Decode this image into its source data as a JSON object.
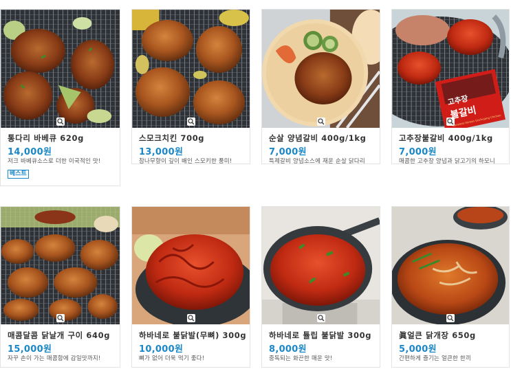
{
  "products": [
    {
      "name": "통다리 바베큐 620g",
      "price": "14,000원",
      "desc": "저크 바베큐소스로 더한 이국적인 맛!",
      "badge": "베스트"
    },
    {
      "name": "스모크치킨 700g",
      "price": "13,000원",
      "desc": "참나무향이 깊이 배인 스모키한 풍미!"
    },
    {
      "name": "순살 양념갈비 400g/1kg",
      "price": "7,000원",
      "desc": "특제갈비 양념소스에 재운 순살 닭다리"
    },
    {
      "name": "고추장불갈비 400g/1kg",
      "price": "7,000원",
      "desc": "매콤한 고추장 양념과 닭고기의 하모니"
    },
    {
      "name": "매콤달콤 닭날개 구이 640g",
      "price": "15,000원",
      "desc": "자꾸 손이 가는 매콤함에 감일맛까지!"
    },
    {
      "name": "하바네로 불닭발(무뼈) 300g",
      "price": "10,000원",
      "desc": "뼈가 없어 더욱 먹기 좋다!"
    },
    {
      "name": "하바네로 튤립 불닭발 300g",
      "price": "8,000원",
      "desc": "중독되는 화끈한 매운 맛!"
    },
    {
      "name": "眞얼큰 닭개장 650g",
      "price": "5,000원",
      "desc": "간편하게 즐기는 얼큰한 한끼"
    }
  ],
  "product_images": [
    "grill-bbq-drumsticks",
    "smoked-chicken-grill",
    "boneless-galbi-plate",
    "gochujang-bulgalbi-grill",
    "spicy-wings-grill",
    "habanero-boneless-feet",
    "habanero-tulip-feet-pan",
    "spicy-chicken-soup-bowl"
  ],
  "package_text": {
    "line1": "고추장",
    "line2": "불갈비",
    "line3": "Boneless Korean Gochujang Chicken"
  },
  "icons": {
    "zoom": "magnifier-icon"
  },
  "colors": {
    "price": "#1a87c8",
    "border": "#e3e3e3",
    "name": "#333333",
    "desc": "#555555"
  }
}
